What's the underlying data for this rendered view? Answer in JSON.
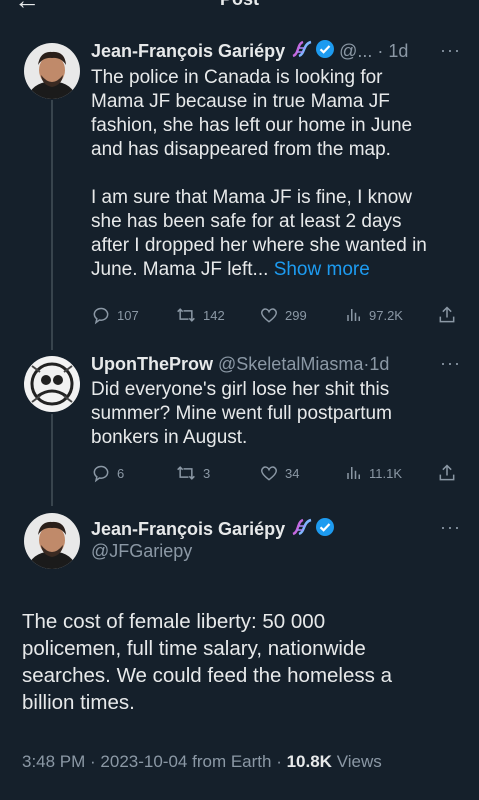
{
  "header": {
    "title": "Post"
  },
  "tweets": [
    {
      "name": "Jean-François Gariépy",
      "handle": "@...",
      "time": "1d",
      "text_lines": [
        "The police in Canada is looking for",
        "Mama JF because in true Mama JF",
        "fashion, she has left our home in June",
        "and has disappeared from the map.",
        "",
        "I am sure that Mama JF is fine, I know",
        "she has been safe for at least 2 days",
        "after I dropped her where she wanted in"
      ],
      "text_last": "June. Mama JF left...",
      "show_more": "Show more",
      "replies": "107",
      "reposts": "142",
      "likes": "299",
      "views": "97.2K"
    },
    {
      "name": "UponTheProw",
      "handle": "@SkeletalMiasma",
      "time": "1d",
      "text_lines": [
        "Did everyone's girl lose her shit this",
        "summer? Mine went full postpartum",
        "bonkers in August."
      ],
      "replies": "6",
      "reposts": "3",
      "likes": "34",
      "views": "11.1K"
    }
  ],
  "main_tweet": {
    "name": "Jean-François Gariépy",
    "handle": "@JFGariepy",
    "text_lines": [
      "The cost of female liberty: 50 000",
      "policemen, full time salary, nationwide",
      "searches. We could feed the homeless a",
      "billion times."
    ],
    "time": "3:48 PM",
    "date": "2023-10-04",
    "source": "from Earth",
    "views_count": "10.8K",
    "views_label": "Views"
  },
  "colors": {
    "background": "#15202b",
    "accent": "#1d9bf0",
    "muted": "#8b98a5",
    "text": "#e7e9ea"
  },
  "icons": [
    "back-arrow-icon",
    "dna-icon",
    "verified-icon",
    "more-icon",
    "reply-icon",
    "repost-icon",
    "like-icon",
    "views-icon",
    "share-icon"
  ]
}
